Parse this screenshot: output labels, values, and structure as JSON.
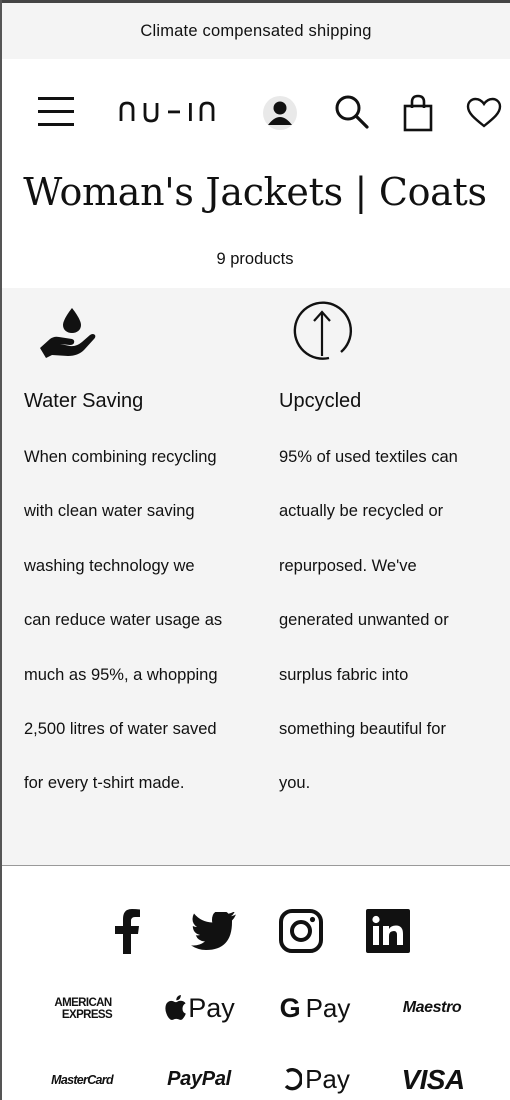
{
  "announcement": "Climate compensated shipping",
  "header": {
    "logo_text": "nu-in",
    "menu_icon": "hamburger-menu-icon",
    "account_icon": "account-icon",
    "search_icon": "search-icon",
    "bag_icon": "shopping-bag-icon",
    "wishlist_icon": "heart-icon"
  },
  "page": {
    "title": "Woman's Jackets | Coats",
    "product_count": "9 products"
  },
  "features": [
    {
      "icon": "water-drop-hand-icon",
      "title": "Water Saving",
      "lines": [
        "When combining recycling",
        "with clean water saving",
        "washing technology we",
        "can reduce water usage as",
        "much as 95%, a whopping",
        "2,500 litres of water saved",
        "for every t-shirt made."
      ]
    },
    {
      "icon": "upcycle-arrow-icon",
      "title": "Upcycled",
      "lines": [
        "95% of used textiles can",
        "actually be recycled or",
        "repurposed. We've",
        "generated unwanted or",
        "surplus fabric into",
        "something beautiful for",
        "you."
      ]
    }
  ],
  "social": [
    "facebook-icon",
    "twitter-icon",
    "instagram-icon",
    "linkedin-icon"
  ],
  "payments": {
    "amex_line1": "AMERICAN",
    "amex_line2": "EXPRESS",
    "apple_pay": "Pay",
    "google_pay": "Pay",
    "maestro": "Maestro",
    "mastercard": "MasterCard",
    "paypal": "PayPal",
    "o_pay": "Pay",
    "visa": "VISA"
  },
  "colors": {
    "band": "#f4f4f4",
    "text": "#111111"
  }
}
